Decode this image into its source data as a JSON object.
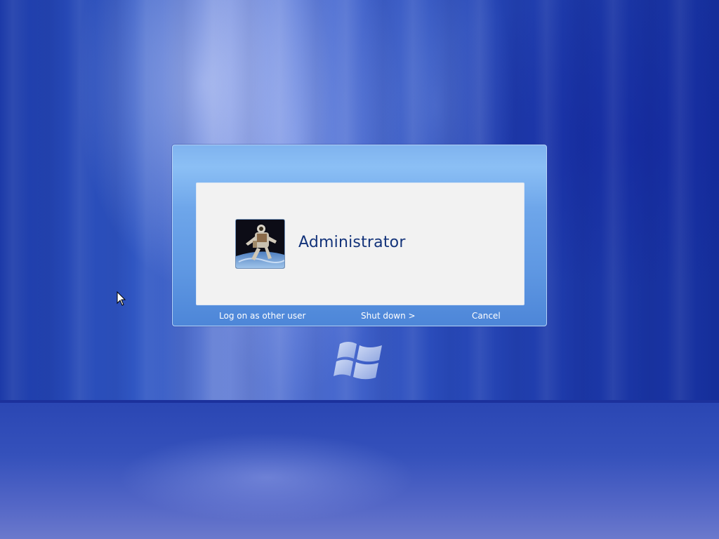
{
  "login_dialog": {
    "user": {
      "name": "Administrator",
      "avatar_icon": "astronaut-picture"
    },
    "actions": {
      "log_on_other": "Log on as other user",
      "shut_down": "Shut down >",
      "cancel": "Cancel"
    }
  },
  "logo": "windows-logo",
  "colors": {
    "background": "#2a4cbb",
    "dialog_frame": "#6ea6ea",
    "panel": "#f2f2f2",
    "username_text": "#13337a",
    "link_text": "#ffffff"
  }
}
